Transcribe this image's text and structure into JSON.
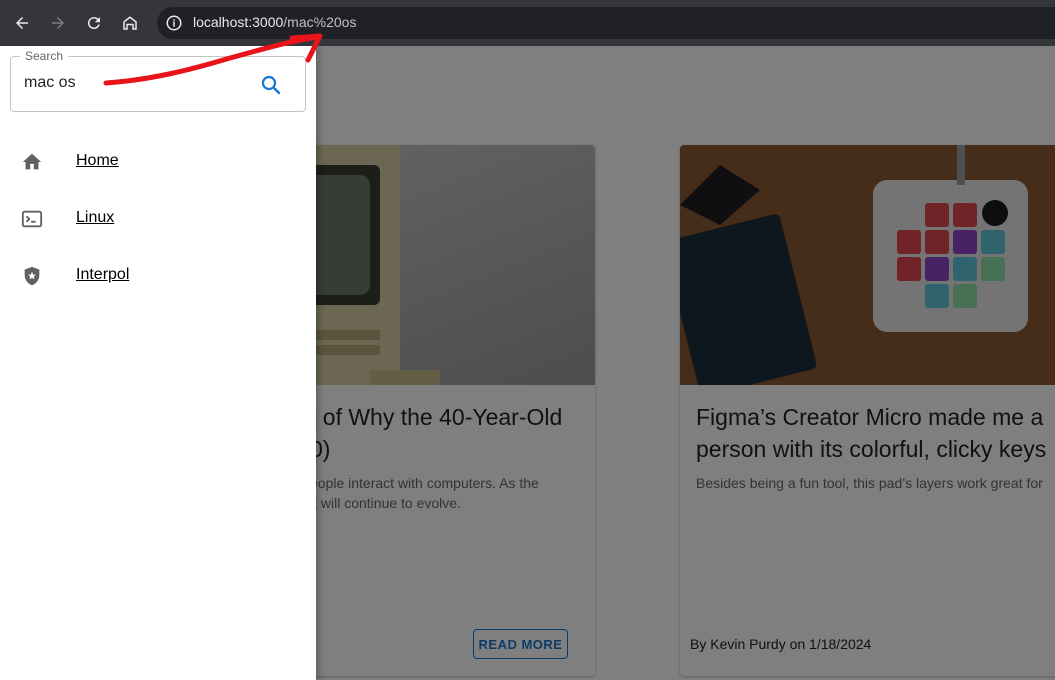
{
  "browser": {
    "url_host": "localhost:3000",
    "url_path": "/mac%20os",
    "buttons": {
      "back": "arrow-left-icon",
      "forward": "arrow-right-icon",
      "reload": "reload-icon",
      "home": "home-icon",
      "site_info": "info-icon"
    }
  },
  "drawer": {
    "search": {
      "legend": "Search",
      "value": "mac os",
      "button_icon": "search-icon"
    },
    "nav": [
      {
        "label": "Home",
        "icon": "home-icon"
      },
      {
        "label": "Linux",
        "icon": "terminal-icon"
      },
      {
        "label": "Interpol",
        "icon": "shield-star-icon"
      }
    ]
  },
  "cards": [
    {
      "title_line1": "t of Why the 40-Year-Old",
      "title_line2": "0)",
      "desc_line1": "eople interact with computers. As the",
      "desc_line2": "it will continue to evolve.",
      "action": "READ MORE"
    },
    {
      "title_line1": "Figma’s Creator Micro made me a",
      "title_line2": "person with its colorful, clicky keys",
      "desc_line1": "Besides being a fun tool, this pad’s layers work great for",
      "byline": "By Kevin Purdy on 1/18/2024"
    }
  ],
  "colors": {
    "accent": "#1976d2",
    "chrome_bg": "#35363a",
    "annotation": "#e8141a"
  }
}
